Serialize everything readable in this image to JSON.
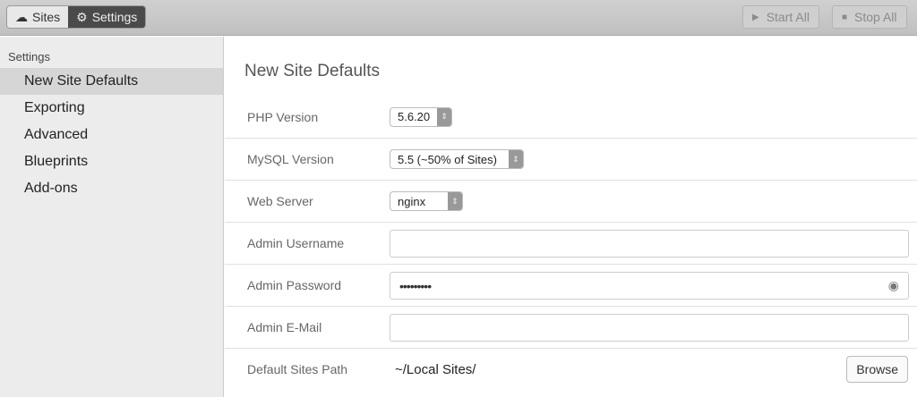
{
  "toolbar": {
    "sites": "Sites",
    "settings": "Settings",
    "start_all": "Start All",
    "stop_all": "Stop All"
  },
  "sidebar": {
    "heading": "Settings",
    "items": [
      {
        "label": "New Site Defaults"
      },
      {
        "label": "Exporting"
      },
      {
        "label": "Advanced"
      },
      {
        "label": "Blueprints"
      },
      {
        "label": "Add-ons"
      }
    ]
  },
  "main": {
    "title": "New Site Defaults",
    "php": {
      "label": "PHP Version",
      "value": "5.6.20"
    },
    "mysql": {
      "label": "MySQL Version",
      "value": "5.5 (~50% of Sites)"
    },
    "web": {
      "label": "Web Server",
      "value": "nginx"
    },
    "user": {
      "label": "Admin Username",
      "value": ""
    },
    "pass": {
      "label": "Admin Password",
      "value": "•••••••••"
    },
    "email": {
      "label": "Admin E-Mail",
      "value": ""
    },
    "path": {
      "label": "Default Sites Path",
      "value": "~/Local Sites/",
      "browse": "Browse"
    }
  }
}
